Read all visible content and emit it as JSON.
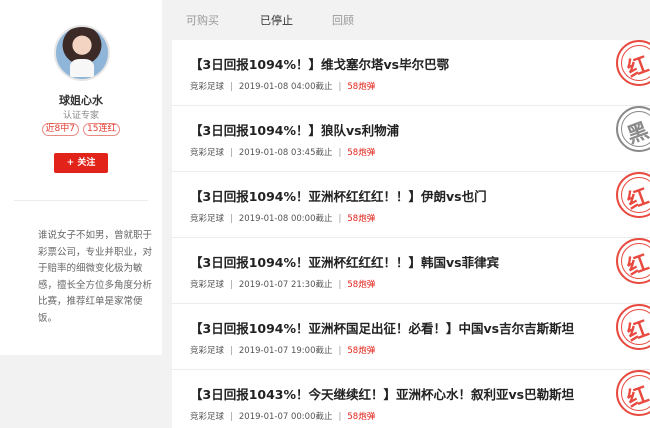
{
  "profile": {
    "name": "球姐心水",
    "certification": "认证专家",
    "tags": [
      "近8中7",
      "15连红"
    ],
    "follow_label": "+ 关注",
    "bio": "谁说女子不如男，曾就职于彩票公司，专业并职业，对于赔率的细微变化极为敏感，擅长全方位多角度分析比赛，推荐红单是家常便饭。"
  },
  "tabs": [
    {
      "label": "可购买",
      "active": false
    },
    {
      "label": "已停止",
      "active": true
    },
    {
      "label": "回顾",
      "active": false
    }
  ],
  "items": [
    {
      "title": "【3日回报1094%！】维戈塞尔塔vs毕尔巴鄂",
      "category": "竞彩足球",
      "time": "2019-01-08 04:00截止",
      "count": "58炮弹",
      "stamp": "红",
      "stamp_color": "#e84a3f"
    },
    {
      "title": "【3日回报1094%！】狼队vs利物浦",
      "category": "竞彩足球",
      "time": "2019-01-08 03:45截止",
      "count": "58炮弹",
      "stamp": "黑",
      "stamp_color": "#8a8a8a"
    },
    {
      "title": "【3日回报1094%！亚洲杯红红红！！】伊朗vs也门",
      "category": "竞彩足球",
      "time": "2019-01-08 00:00截止",
      "count": "58炮弹",
      "stamp": "红",
      "stamp_color": "#e84a3f"
    },
    {
      "title": "【3日回报1094%！亚洲杯红红红！！】韩国vs菲律宾",
      "category": "竞彩足球",
      "time": "2019-01-07 21:30截止",
      "count": "58炮弹",
      "stamp": "红",
      "stamp_color": "#e84a3f"
    },
    {
      "title": "【3日回报1094%！亚洲杯国足出征！必看！】中国vs吉尔吉斯斯坦",
      "category": "竞彩足球",
      "time": "2019-01-07 19:00截止",
      "count": "58炮弹",
      "stamp": "红",
      "stamp_color": "#e84a3f"
    },
    {
      "title": "【3日回报1043%！今天继续红！】亚洲杯心水！叙利亚vs巴勒斯坦",
      "category": "竞彩足球",
      "time": "2019-01-07 00:00截止",
      "count": "58炮弹",
      "stamp": "红",
      "stamp_color": "#e84a3f"
    }
  ]
}
